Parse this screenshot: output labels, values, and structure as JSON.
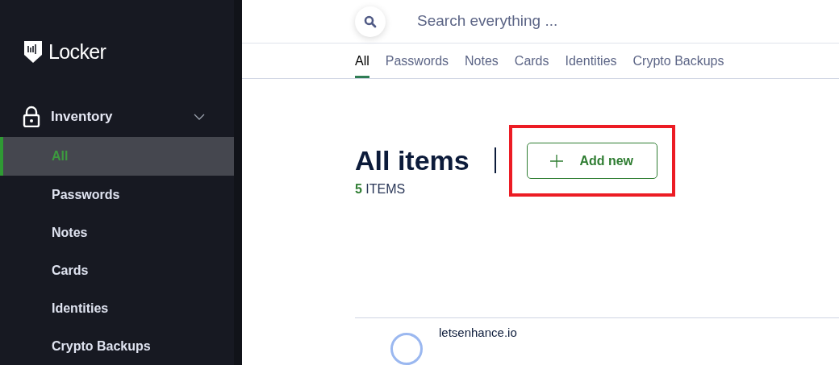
{
  "app": {
    "name": "Locker"
  },
  "sidebar": {
    "section": {
      "label": "Inventory",
      "expanded": true
    },
    "items": [
      {
        "label": "All",
        "selected": true
      },
      {
        "label": "Passwords",
        "selected": false
      },
      {
        "label": "Notes",
        "selected": false
      },
      {
        "label": "Cards",
        "selected": false
      },
      {
        "label": "Identities",
        "selected": false
      },
      {
        "label": "Crypto Backups",
        "selected": false
      }
    ]
  },
  "search": {
    "placeholder": "Search everything ..."
  },
  "tabs": [
    {
      "label": "All",
      "selected": true
    },
    {
      "label": "Passwords",
      "selected": false
    },
    {
      "label": "Notes",
      "selected": false
    },
    {
      "label": "Cards",
      "selected": false
    },
    {
      "label": "Identities",
      "selected": false
    },
    {
      "label": "Crypto Backups",
      "selected": false
    }
  ],
  "heading": {
    "title": "All items",
    "count": "5",
    "count_unit": "ITEMS"
  },
  "add_button": {
    "label": "Add new",
    "highlighted": true
  },
  "rows": [
    {
      "name": "letsenhance.io"
    }
  ]
}
